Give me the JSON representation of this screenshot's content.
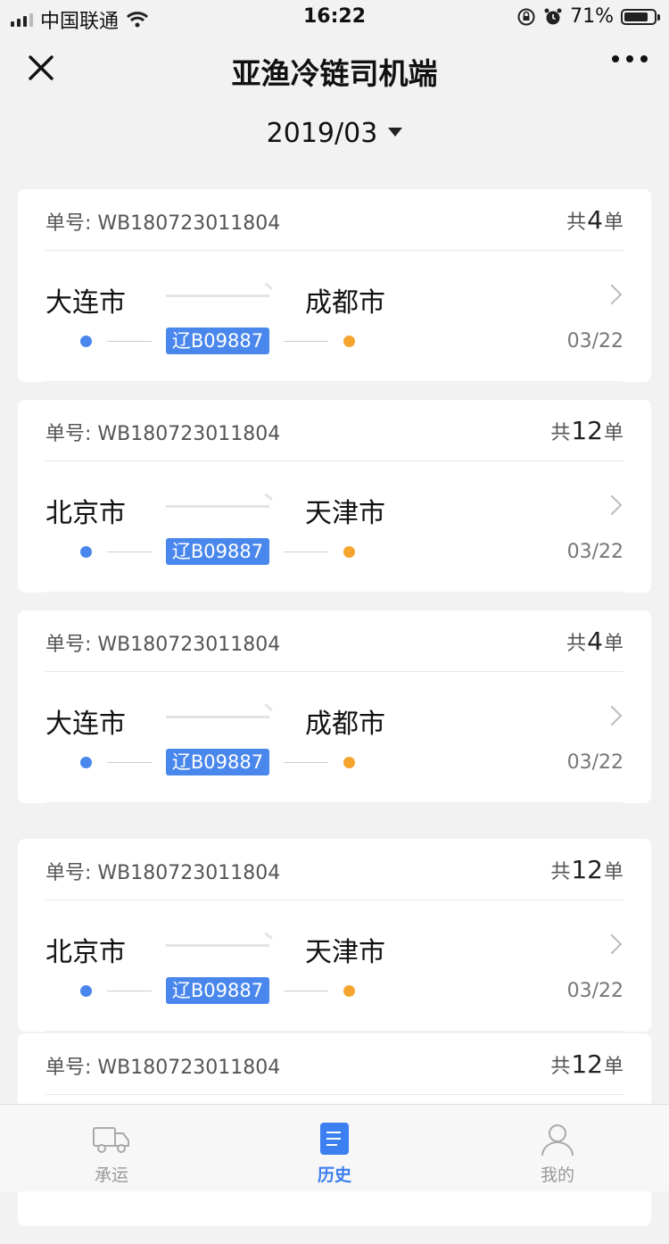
{
  "status_bar": {
    "carrier": "中国联通",
    "time": "16:22",
    "battery": "71%",
    "icons": [
      "signal-icon",
      "wifi-icon",
      "rotation-lock-icon",
      "alarm-icon",
      "battery-icon"
    ]
  },
  "nav": {
    "title": "亚渔冷链司机端",
    "close_icon": "close-icon",
    "more_icon": "more-icon"
  },
  "filter": {
    "month": "2019/03"
  },
  "orders": [
    {
      "order_label": "单号:",
      "order_no": "WB180723011804",
      "count_prefix": "共",
      "count": "4",
      "count_suffix": "单",
      "from": "大连市",
      "to": "成都市",
      "plate": "辽B09887",
      "date": "03/22"
    },
    {
      "order_label": "单号:",
      "order_no": "WB180723011804",
      "count_prefix": "共",
      "count": "12",
      "count_suffix": "单",
      "from": "北京市",
      "to": "天津市",
      "plate": "辽B09887",
      "date": "03/22"
    },
    {
      "order_label": "单号:",
      "order_no": "WB180723011804",
      "count_prefix": "共",
      "count": "4",
      "count_suffix": "单",
      "from": "大连市",
      "to": "成都市",
      "plate": "辽B09887",
      "date": "03/22"
    },
    {
      "order_label": "单号:",
      "order_no": "WB180723011804",
      "count_prefix": "共",
      "count": "12",
      "count_suffix": "单",
      "from": "北京市",
      "to": "天津市",
      "plate": "辽B09887",
      "date": "03/22"
    },
    {
      "order_label": "单号:",
      "order_no": "WB180723011804",
      "count_prefix": "共",
      "count": "12",
      "count_suffix": "单"
    }
  ],
  "tabs": [
    {
      "label": "承运",
      "icon": "truck-icon",
      "active": false
    },
    {
      "label": "历史",
      "icon": "document-icon",
      "active": true
    },
    {
      "label": "我的",
      "icon": "user-icon",
      "active": false
    }
  ],
  "colors": {
    "accent": "#4a87ec",
    "destination_dot": "#f5a52f",
    "background": "#f2f2f2"
  }
}
